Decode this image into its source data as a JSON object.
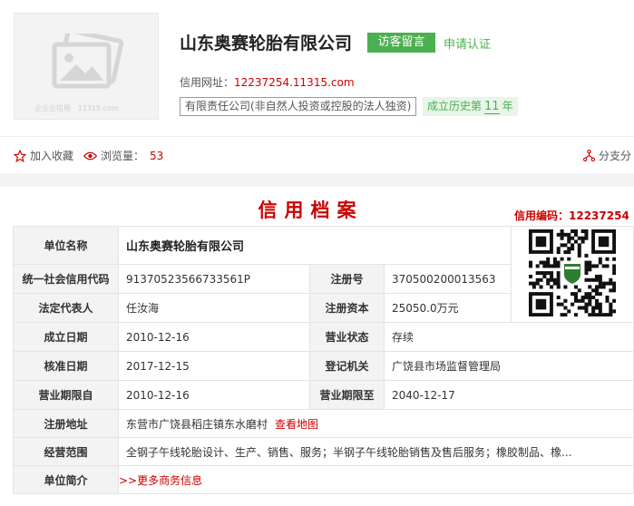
{
  "header": {
    "logo_watermark": "企业业信用 · 11315.com",
    "company_name": "山东奥赛轮胎有限公司",
    "visitor_button": "访客留言",
    "apply_link": "申请认证",
    "credit_url_label": "信用网址：",
    "credit_url": "12237254.11315.com",
    "company_type": "有限责任公司(非自然人投资或控股的法人独资)",
    "history_prefix": "成立历史第",
    "history_years": "11",
    "history_suffix": "年"
  },
  "toolbar": {
    "favorite_label": "加入收藏",
    "views_label": "浏览量：",
    "views_count": "53",
    "share_label": "分支分"
  },
  "archive": {
    "title": "信用档案",
    "credit_code": "信用编码：12237254",
    "labels": {
      "unit_name": "单位名称",
      "social_credit_code": "统一社会信用代码",
      "reg_no": "注册号",
      "legal_rep": "法定代表人",
      "reg_capital": "注册资本",
      "est_date": "成立日期",
      "status": "营业状态",
      "approval_date": "核准日期",
      "authority": "登记机关",
      "term_from": "营业期限自",
      "term_to": "营业期限至",
      "address": "注册地址",
      "scope": "经营范围",
      "intro": "单位简介"
    },
    "values": {
      "unit_name": "山东奥赛轮胎有限公司",
      "social_credit_code": "91370523566733561P",
      "reg_no": "370500200013563",
      "legal_rep": "任汝海",
      "reg_capital": "25050.0万元",
      "est_date": "2010-12-16",
      "status": "存续",
      "approval_date": "2017-12-15",
      "authority": "广饶县市场监督管理局",
      "term_from": "2010-12-16",
      "term_to": "2040-12-17",
      "address": "东营市广饶县稻庄镇东水磨村",
      "map_link": "查看地图",
      "scope": "全钢子午线轮胎设计、生产、销售、服务；半钢子午线轮胎销售及售后服务；橡胶制品、橡...",
      "more_info": ">>更多商务信息"
    }
  },
  "colors": {
    "brand_green": "#4caf50",
    "accent_red": "#cc0000"
  },
  "icons": [
    "image-placeholder-icon",
    "star-icon",
    "eye-icon",
    "branch-icon",
    "qr-code-icon"
  ]
}
